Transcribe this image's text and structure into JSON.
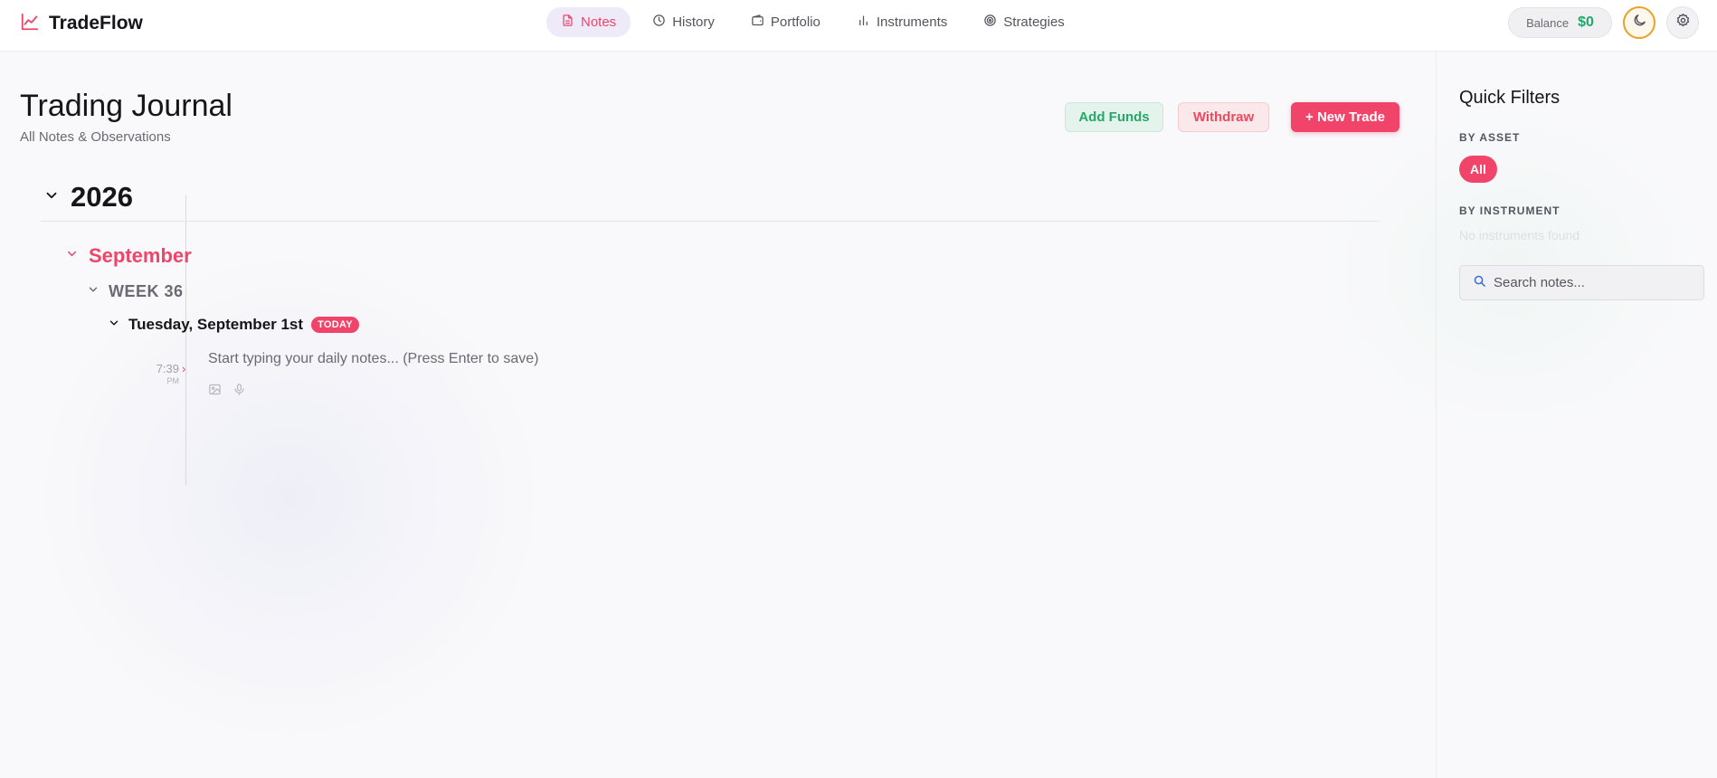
{
  "app": {
    "name": "TradeFlow",
    "logo_icon": "chart-line-icon",
    "accent": "#f0446a"
  },
  "nav": {
    "items": [
      {
        "label": "Notes",
        "icon": "document-icon",
        "active": true
      },
      {
        "label": "History",
        "icon": "clock-icon",
        "active": false
      },
      {
        "label": "Portfolio",
        "icon": "wallet-icon",
        "active": false
      },
      {
        "label": "Instruments",
        "icon": "bar-chart-icon",
        "active": false
      },
      {
        "label": "Strategies",
        "icon": "target-icon",
        "active": false
      }
    ]
  },
  "header": {
    "balance_label": "Balance",
    "balance_value": "$0",
    "theme_icon": "moon-icon",
    "settings_icon": "gear-icon"
  },
  "page": {
    "title": "Trading Journal",
    "subtitle": "All Notes & Observations"
  },
  "actions": {
    "add_funds": "Add Funds",
    "withdraw": "Withdraw",
    "new_trade": "+ New Trade"
  },
  "timeline": {
    "year": "2026",
    "month": "September",
    "week": "WEEK 36",
    "day": "Tuesday, September 1st",
    "today_badge": "TODAY",
    "note": {
      "time": "7:39",
      "ampm": "PM",
      "placeholder": "Start typing your daily notes... (Press Enter to save)",
      "tools": [
        "image-icon",
        "microphone-icon"
      ]
    }
  },
  "filters": {
    "title": "Quick Filters",
    "by_asset": "BY ASSET",
    "asset_chip": "All",
    "by_instrument": "BY INSTRUMENT",
    "empty_instruments": "No instruments found",
    "search_placeholder": "Search notes..."
  },
  "colors": {
    "accent": "#f0446a",
    "success": "#1fa86a",
    "danger": "#ee4a5e",
    "warning": "#e8a227"
  }
}
